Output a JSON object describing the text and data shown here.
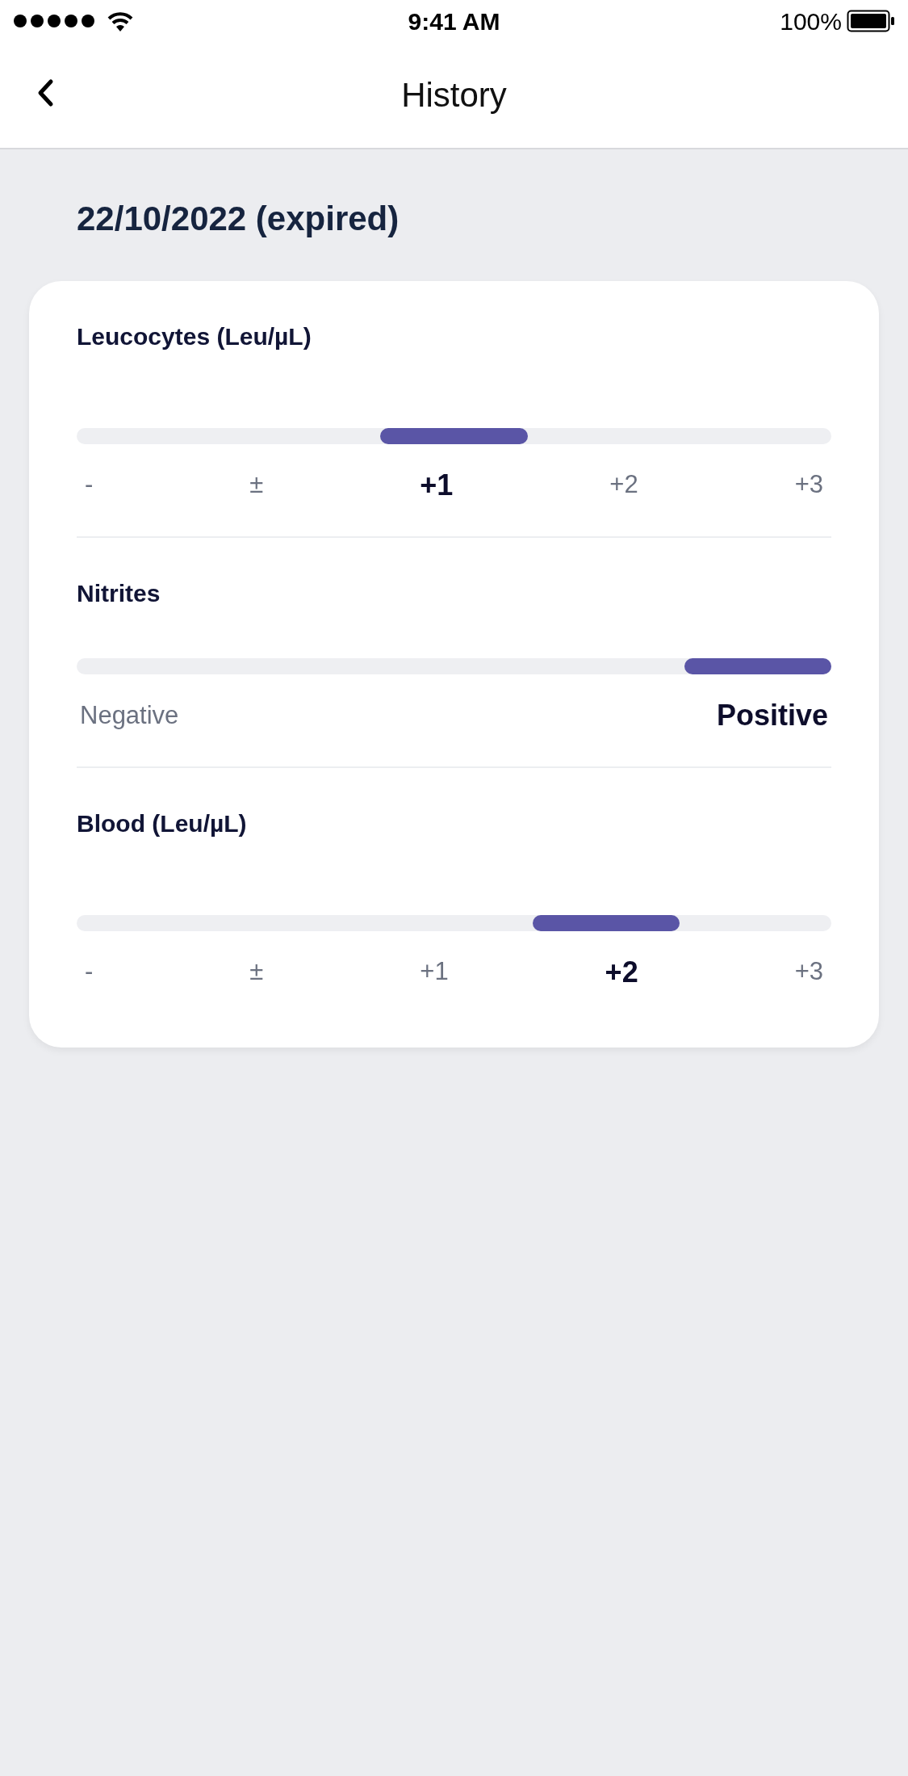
{
  "status_bar": {
    "time": "9:41 AM",
    "battery": "100%"
  },
  "nav": {
    "title": "History"
  },
  "date_heading": "22/10/2022 (expired)",
  "tests": [
    {
      "name": "Leucocytes (Leu/µL)",
      "options": [
        {
          "label": "-",
          "selected": false
        },
        {
          "label": "±",
          "selected": false
        },
        {
          "label": "+1",
          "selected": true
        },
        {
          "label": "+2",
          "selected": false
        },
        {
          "label": "+3",
          "selected": false
        }
      ]
    },
    {
      "name": "Nitrites",
      "options": [
        {
          "label": "Negative",
          "selected": false
        },
        {
          "label": "Positive",
          "selected": true
        }
      ]
    },
    {
      "name": "Blood (Leu/µL)",
      "options": [
        {
          "label": "-",
          "selected": false
        },
        {
          "label": "±",
          "selected": false
        },
        {
          "label": "+1",
          "selected": false
        },
        {
          "label": "+2",
          "selected": true
        },
        {
          "label": "+3",
          "selected": false
        }
      ]
    }
  ]
}
